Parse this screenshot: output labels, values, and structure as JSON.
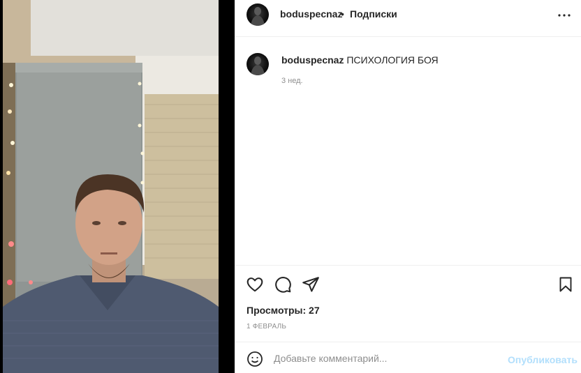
{
  "media": {
    "kind": "video",
    "description_icon": "video-player"
  },
  "header": {
    "username": "boduspecnaz",
    "separator": "•",
    "follow_label": "Подписки",
    "more_icon": "more-horizontal-icon"
  },
  "caption": {
    "username": "boduspecnaz",
    "text": "ПСИХОЛОГИЯ БОЯ",
    "time": "3 нед."
  },
  "actions": {
    "like_icon": "heart-icon",
    "comment_icon": "comment-icon",
    "share_icon": "send-icon",
    "save_icon": "bookmark-icon",
    "views_label": "Просмотры: 27",
    "date": "1 ФЕВРАЛЬ"
  },
  "comment_bar": {
    "emoji_icon": "emoji-icon",
    "placeholder": "Добавьте комментарий...",
    "publish_label": "Опубликовать"
  },
  "colors": {
    "link_disabled": "#b2dffc",
    "muted": "#8e8e8e",
    "text": "#262626",
    "border": "#efefef"
  }
}
